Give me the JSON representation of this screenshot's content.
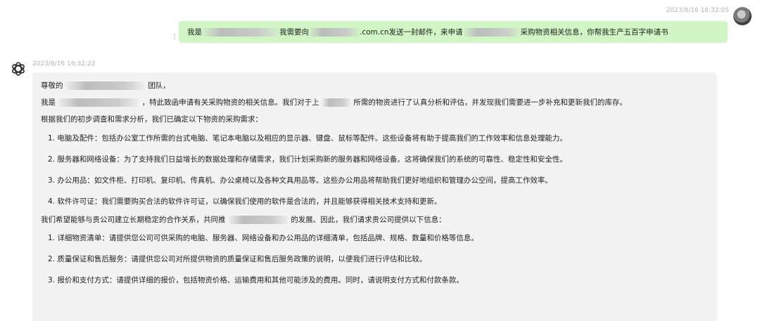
{
  "user_message": {
    "timestamp": "2023/8/16 16:32:05",
    "avatar_icon": "user-avatar-icon",
    "text_part1": "我是",
    "text_part2": "我需要向",
    "text_part3": ".com.cn发送一封邮件，来申请",
    "text_part4": "采购物资相关信息，你帮我生产五百字申请书",
    "bubble_color": "#d2f5c6"
  },
  "assistant_message": {
    "timestamp": "2023/8/16 16:32:22",
    "avatar_icon": "openai-logo-icon",
    "bubble_color": "#f3f3f4",
    "greeting_a": "尊敬的",
    "greeting_b": "团队，",
    "intro_a": "我是",
    "intro_b": "，特此致函申请有关采购物资的相关信息。我们对于上",
    "intro_c": "所需的物资进行了认真分析和评估，并发现我们需要进一步补充和更新我们的库存。",
    "analysis": "根据我们的初步调查和需求分析，我们已确定以下物资的采购需求：",
    "needs": [
      "1. 电脑及配件：包括办公室工作所需的台式电脑、笔记本电脑以及相应的显示器、键盘、鼠标等配件。这些设备将有助于提高我们的工作效率和信息处理能力。",
      "2. 服务器和网络设备：为了支持我们日益增长的数据处理和存储需求，我们计划采购新的服务器和网络设备。这将确保我们的系统的可靠性、稳定性和安全性。",
      "3. 办公用品：如文件柜、打印机、复印机、传真机、办公桌椅以及各种文具用品等。这些办公用品将帮助我们更好地组织和管理办公空间，提高工作效率。",
      "4. 软件许可证：我们需要购买合法的软件许可证，以确保我们使用的软件是合法的，并且能够获得相关技术支持和更新。"
    ],
    "hope_a": "我们希望能够与贵公司建立长期稳定的合作关系，共同推",
    "hope_b": "的发展。因此，我们请求贵公司提供以下信息：",
    "requests": [
      "1. 详细物资清单：请提供您公司可供采购的电脑、服务器、网络设备和办公用品的详细清单，包括品牌、规格、数量和价格等信息。",
      "2. 质量保证和售后服务：请提供您公司对所提供物资的质量保证和售后服务政策的说明，以便我们进行评估和比较。",
      "3. 报价和支付方式：请提供详细的报价，包括物资价格、运输费用和其他可能涉及的费用。同时，请说明支付方式和付款条款。"
    ]
  }
}
